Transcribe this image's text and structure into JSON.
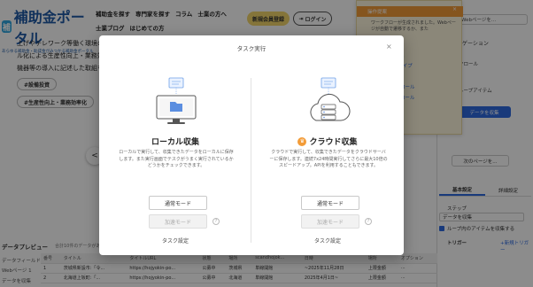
{
  "site": {
    "logo_text": "補助金ポータル",
    "logo_mark": "補",
    "logo_tagline": "あらゆる補助金・助成金がみつかる補助金ポータル",
    "nav_row1": [
      "補助金を探す",
      "専門家を探す",
      "コラム",
      "士業の方へ"
    ],
    "nav_row2": [
      "士業ブログ",
      "はじめての方"
    ],
    "register_button": "新規会員登録",
    "login_button": "ログイン",
    "hero_lines": [
      "上げやテレワーク等働く環境の整",
      "ル化による生産性向上・業務効率",
      "機器等の導入に記述した取組を支"
    ],
    "tags": [
      "#設備投資",
      "#生産性向上・業務効率化"
    ],
    "prev_arrow": "<",
    "hero_tab": "1"
  },
  "notification": {
    "title": "操作提案",
    "body": "ワークフローが生成されました。Webページが自動で遷移するか、また",
    "items": [
      "ループアイテム",
      "「ク」「テ」タイプ",
      "タイプ",
      "リストをスクロール",
      "ページをスクロール",
      "リストを選択",
      "ループ"
    ]
  },
  "right_panel": {
    "url_field": "Webページを...",
    "heading": "ナビゲーション",
    "items": [
      "クロール",
      "ループアイテム"
    ],
    "action_button": "データを収集",
    "next_button": "次のページを...",
    "tabs": [
      "基本設定",
      "詳細設定"
    ],
    "step_label": "ステップ",
    "step_value": "データを収集",
    "loop_checkbox": "ループ内のアイテムを収集する",
    "trigger_label": "トリガー",
    "new_trigger": "+新規トリガー"
  },
  "data_preview": {
    "title": "データプレビュー",
    "subtitle": "合計10件のデータがありま...",
    "side_items": [
      "データフィールド",
      "Webページ 1",
      "データを収集"
    ],
    "columns": [
      "番号",
      "タイトル",
      "タイトルURL",
      "状態",
      "場所",
      "scandhojok...",
      "日時",
      "場所",
      "オプション"
    ],
    "rows": [
      [
        "1",
        "茨城県新設市:「令...",
        "https://hojyokin-po...",
        "公募中",
        "茨城県",
        "単線開館",
        "~2025年11月28日",
        "上限金額"
      ],
      [
        "2",
        "北海道上坂町:「...",
        "https://hojyokin-po...",
        "公募中",
        "北海道",
        "単線開館",
        "2025年4月1日~",
        "上限金額"
      ]
    ]
  },
  "modal": {
    "title": "タスク実行",
    "close_glyph": "×",
    "local": {
      "title": "ローカル収集",
      "description": "ローカルで実行して、収集できたデータをローカルに保存します。また実行画面でテスクがうまく実行されているかどうかをチェックできます。",
      "normal_mode": "通常モード",
      "fast_mode": "加速モード",
      "task_settings": "タスク設定"
    },
    "cloud": {
      "title": "クラウド収集",
      "description": "クラウドで実行して、収集できたデータをクラウドサーバーに保存します。連続7x24時間実行してさらに最大10倍のスピードアップ。APIを利用することもできます。",
      "normal_mode": "通常モード",
      "fast_mode": "加速モード",
      "task_settings": "タスク設定"
    }
  },
  "colors": {
    "accent": "#2f6be0",
    "brand_blue": "#1f5aa6",
    "warning_orange": "#f39c38",
    "member_yellow": "#f3d66b"
  }
}
